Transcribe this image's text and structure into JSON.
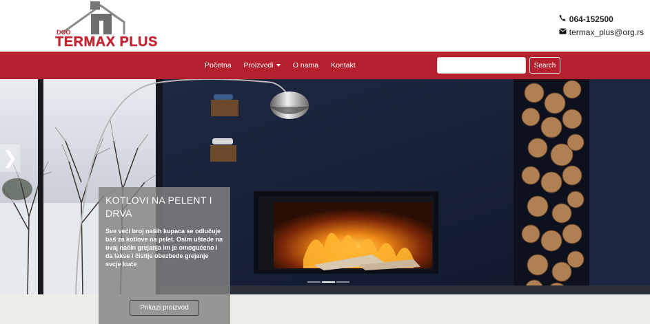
{
  "brand": {
    "doo": "DOO",
    "name": "TERMAX PLUS",
    "colors": {
      "primary": "#b5202e",
      "logo_red": "#c4232f",
      "logo_grey": "#777777"
    }
  },
  "contact": {
    "phone_icon": "phone-icon",
    "phone": "064-152500",
    "email_icon": "envelope-icon",
    "email": "termax_plus@org.rs"
  },
  "nav": {
    "items": [
      {
        "label": "Početna"
      },
      {
        "label": "Proizvodi"
      },
      {
        "label": "O nama"
      },
      {
        "label": "Kontakt"
      }
    ]
  },
  "search": {
    "placeholder": "",
    "button_label": "Search"
  },
  "carousel": {
    "prev_glyph": "❯",
    "slide": {
      "title": "KOTLOVI NA PELENT I DRVA",
      "text": "Sve veći broj naših kupaca se odlučuje baš za kotlove na pelet. Osim uštede na ovaj način grejanja im je omogućeno i da lakse i čistije obezbede grejanje svcje kuće",
      "button_label": "Prikazi proizvod"
    },
    "slide_count": 3,
    "active_index": 1
  }
}
